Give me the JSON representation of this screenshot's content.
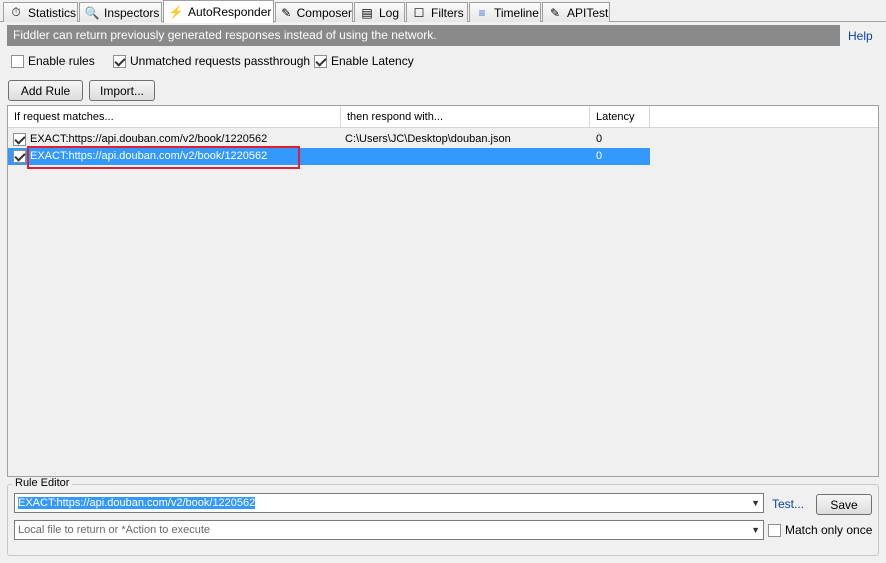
{
  "tabs": [
    {
      "label": "Statistics",
      "icon": "stopwatch-icon",
      "glyph": "⏱"
    },
    {
      "label": "Inspectors",
      "icon": "magnifier-icon",
      "glyph": "🔍"
    },
    {
      "label": "AutoResponder",
      "icon": "lightning-icon",
      "glyph": "⚡"
    },
    {
      "label": "Composer",
      "icon": "composer-icon",
      "glyph": "✎"
    },
    {
      "label": "Log",
      "icon": "log-icon",
      "glyph": "▤"
    },
    {
      "label": "Filters",
      "icon": "filter-checkbox-icon",
      "glyph": "☐"
    },
    {
      "label": "Timeline",
      "icon": "timeline-icon",
      "glyph": "≡"
    },
    {
      "label": "APITest",
      "icon": "apitest-icon",
      "glyph": "✎"
    }
  ],
  "infobar": {
    "text": "Fiddler can return previously generated responses instead of using the network.",
    "help": "Help"
  },
  "options": {
    "enable_rules": {
      "label": "Enable rules",
      "checked": false
    },
    "unmatched_passthrough": {
      "label": "Unmatched requests passthrough",
      "checked": true
    },
    "enable_latency": {
      "label": "Enable Latency",
      "checked": true
    }
  },
  "buttons": {
    "add_rule": "Add Rule",
    "import": "Import..."
  },
  "rules_table": {
    "columns": [
      "If request matches...",
      "then respond with...",
      "Latency"
    ],
    "rows": [
      {
        "checked": true,
        "match": "EXACT:https://api.douban.com/v2/book/1220562",
        "respond": "C:\\Users\\JC\\Desktop\\douban.json",
        "latency": "0",
        "selected": false
      },
      {
        "checked": true,
        "match": "EXACT:https://api.douban.com/v2/book/1220562",
        "respond": "",
        "latency": "0",
        "selected": true
      }
    ]
  },
  "rule_editor": {
    "title": "Rule Editor",
    "match_value": "EXACT:https://api.douban.com/v2/book/1220562",
    "action_placeholder": "Local file to return or *Action to execute",
    "test_link": "Test...",
    "save_label": "Save",
    "match_once_label": "Match only once",
    "match_once_checked": false
  },
  "colors": {
    "selection": "#3399ff",
    "infobar": "#8a8a8a",
    "highlight_box": "#e0202e",
    "link": "#0645ad"
  }
}
